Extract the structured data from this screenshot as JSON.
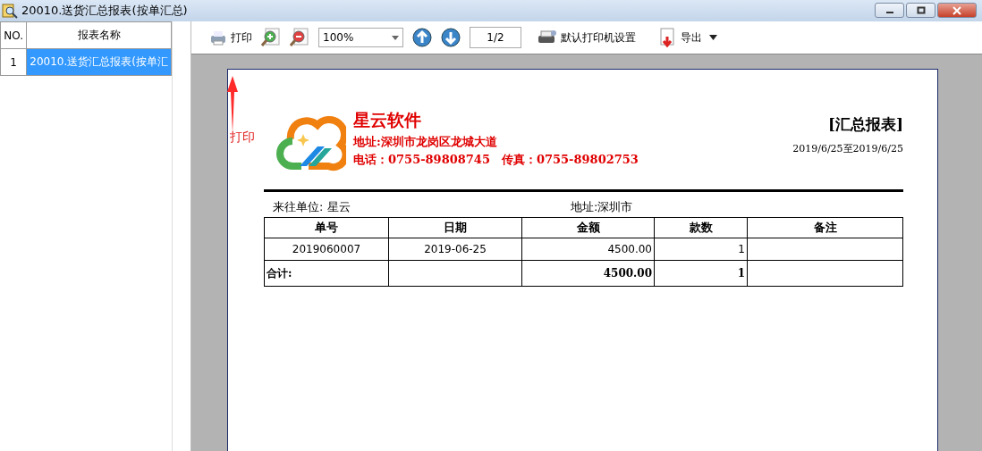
{
  "window": {
    "title": "20010.送货汇总报表(按单汇总)"
  },
  "report_list": {
    "columns": [
      "NO.",
      "报表名称"
    ],
    "rows": [
      {
        "no": "1",
        "name": "20010.送货汇总报表(按单汇",
        "selected": true
      }
    ]
  },
  "toolbar": {
    "print": "打印",
    "zoom": "100%",
    "page": "1/2",
    "printer_setup": "默认打印机设置",
    "export": "导出"
  },
  "annotation": {
    "text": "打印"
  },
  "report": {
    "company": "星云软件",
    "address": "地址:深圳市龙岗区龙城大道",
    "contact": "电话：0755-89808745　传真：0755-89802753",
    "title": "[汇总报表]",
    "date_range": "2019/6/25至2019/6/25",
    "unit": "来往单位: 星云",
    "unit_address": "地址:深圳市",
    "columns": [
      "单号",
      "日期",
      "金额",
      "款数",
      "备注"
    ],
    "rows": [
      {
        "kind": "data",
        "cells": [
          "2019060007",
          "2019-06-25",
          "4500.00",
          "1",
          ""
        ]
      },
      {
        "kind": "total",
        "cells": [
          "合计:",
          "",
          "4500.00",
          "1",
          ""
        ]
      }
    ]
  }
}
